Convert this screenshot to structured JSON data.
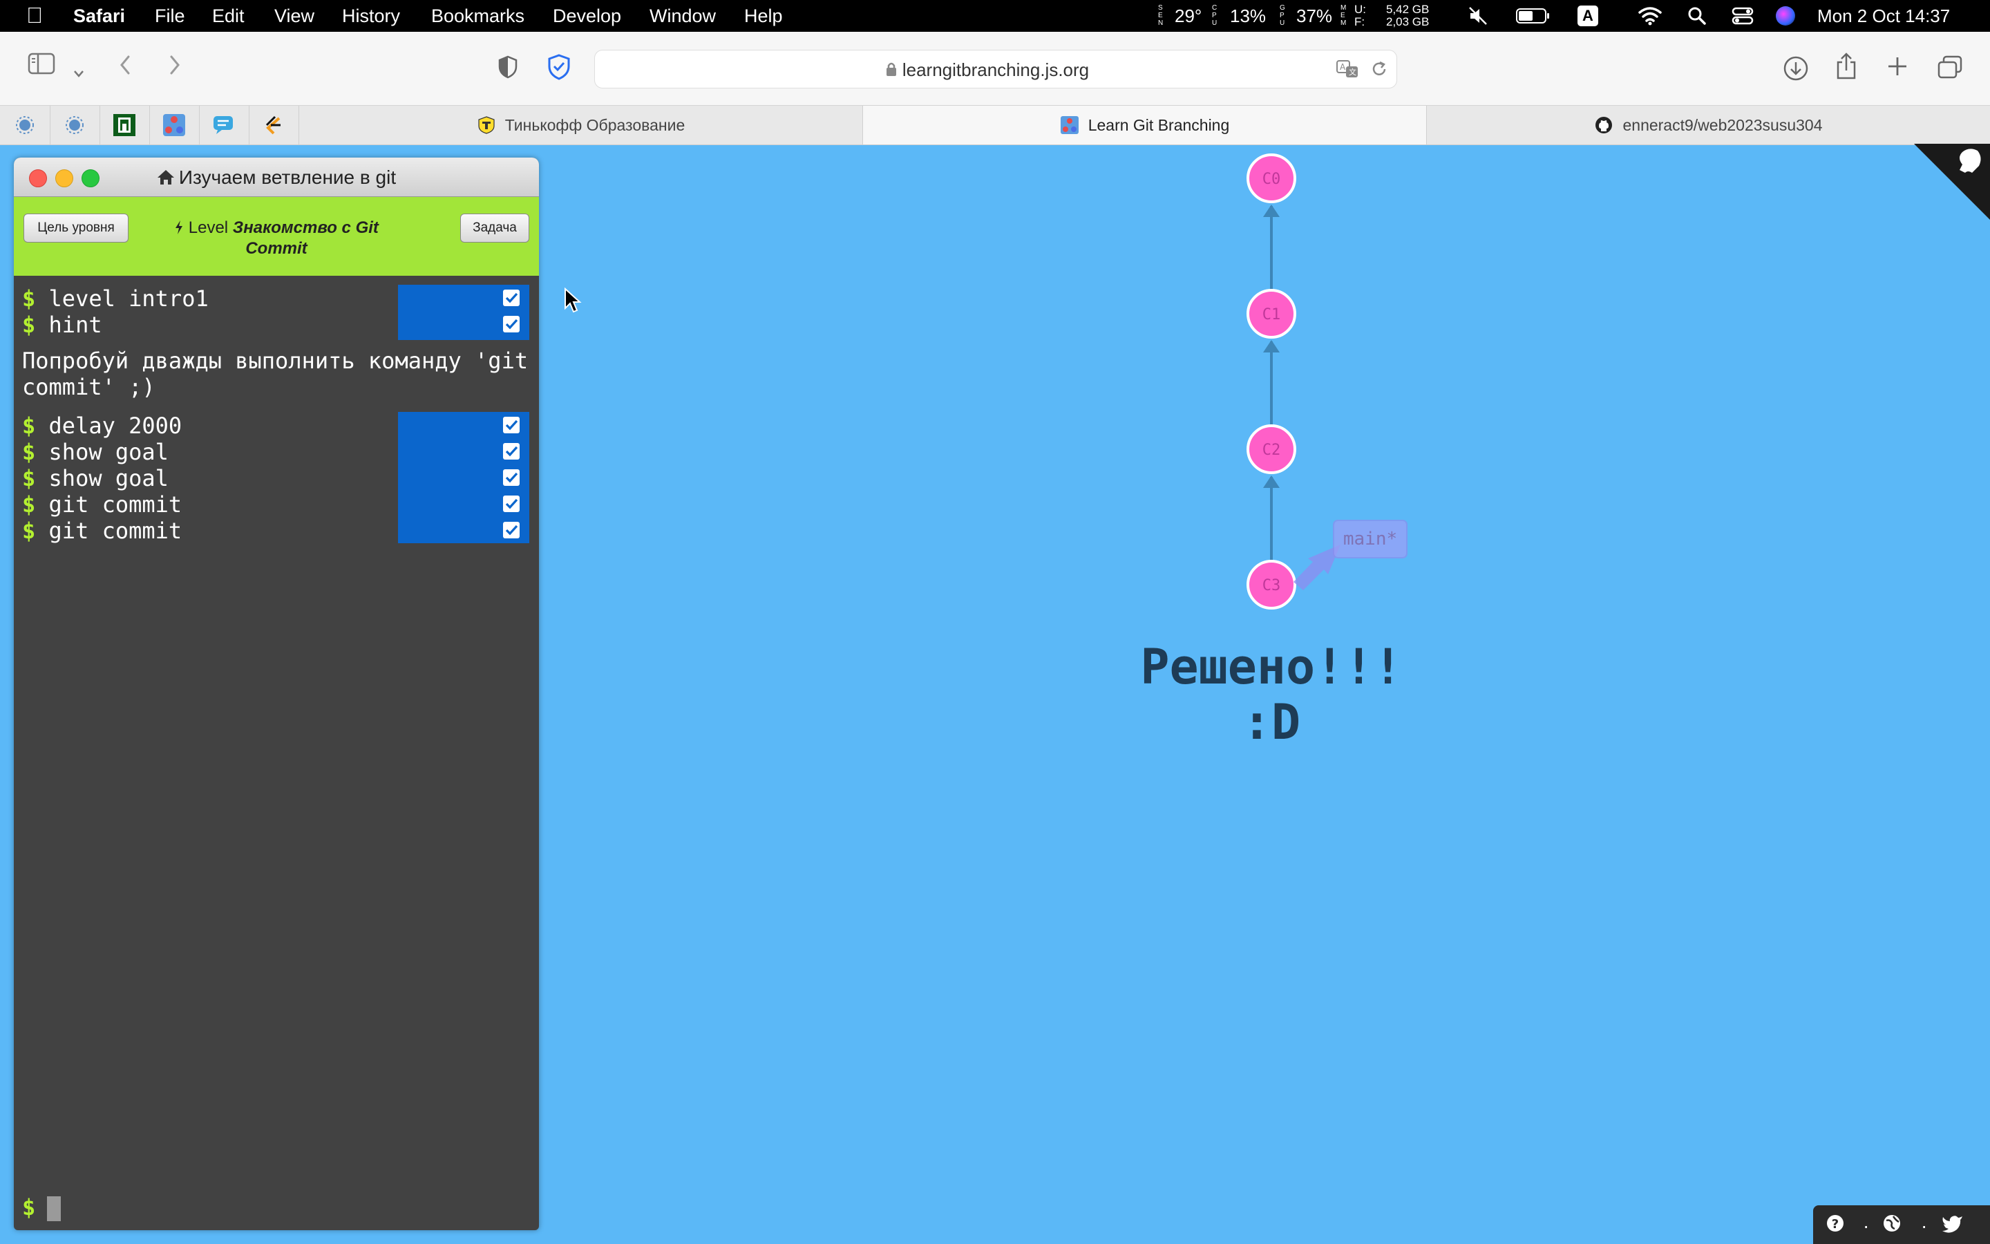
{
  "menubar": {
    "app": "Safari",
    "items": [
      "File",
      "Edit",
      "View",
      "History",
      "Bookmarks",
      "Develop",
      "Window",
      "Help"
    ],
    "status": {
      "temp": "29°",
      "cpu": "13%",
      "gpu": "37%",
      "mem_used": "5,42 GB",
      "mem_free": "2,03 GB",
      "input_source": "A",
      "datetime": "Mon 2 Oct  14:37"
    }
  },
  "toolbar": {
    "url": "learngitbranching.js.org"
  },
  "tabs": [
    {
      "label": "Тинькофф Образование",
      "active": false
    },
    {
      "label": "Learn Git Branching",
      "active": true
    },
    {
      "label": "enneract9/web2023susu304",
      "active": false
    }
  ],
  "console": {
    "window_title": "Изучаем ветвление в git",
    "goal_button": "Цель уровня",
    "task_button": "Задача",
    "level_prefix": "Level",
    "level_name": "Знакомство с Git Commit",
    "commands": [
      {
        "text": "level intro1",
        "done": true
      },
      {
        "text": "hint",
        "done": true
      }
    ],
    "hint": "Попробуй дважды выполнить команду 'git commit' ;)",
    "commands2": [
      {
        "text": "delay 2000",
        "done": true
      },
      {
        "text": "show goal",
        "done": true
      },
      {
        "text": "show goal",
        "done": true
      },
      {
        "text": "git commit",
        "done": true
      },
      {
        "text": "git commit",
        "done": true
      }
    ],
    "prompt": "$"
  },
  "tree": {
    "commits": [
      "C0",
      "C1",
      "C2",
      "C3"
    ],
    "branch": "main*",
    "node_color": "#ff5fc8"
  },
  "result": {
    "line1": "Решено!!!",
    "line2": ":D"
  }
}
